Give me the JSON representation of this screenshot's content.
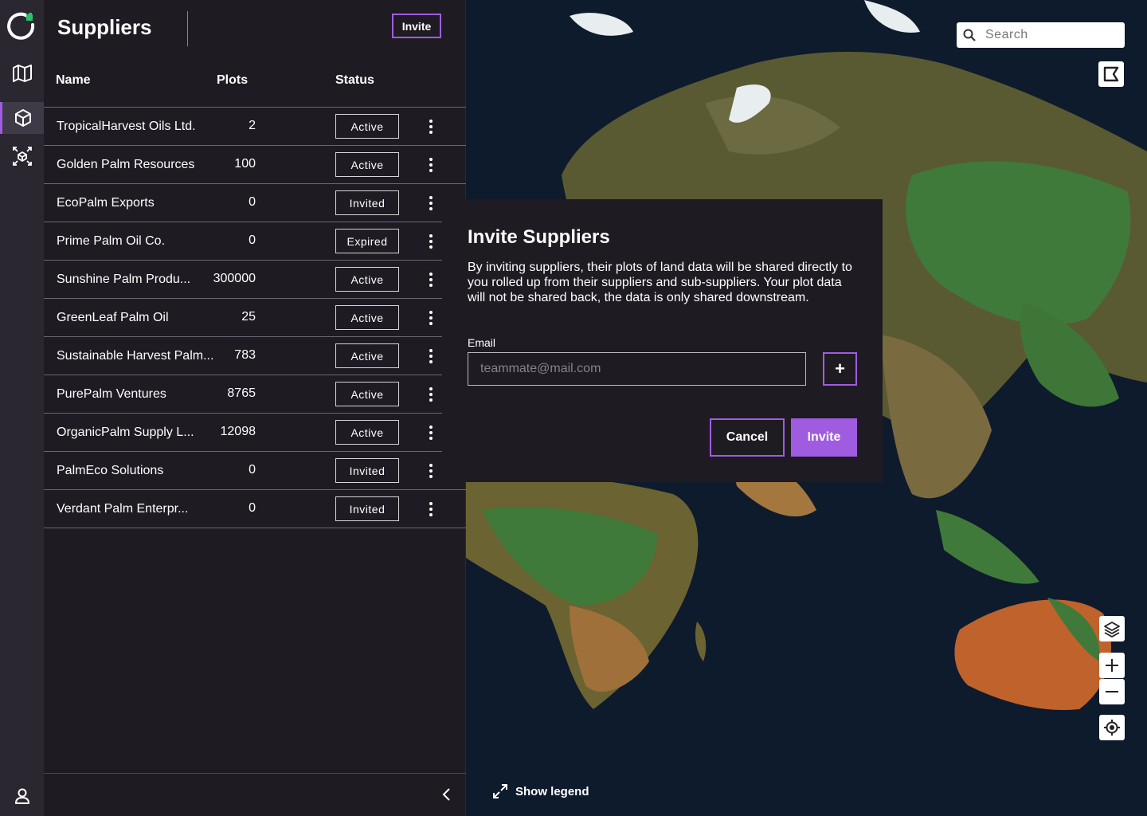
{
  "header": {
    "title": "Suppliers",
    "invite_label": "Invite"
  },
  "table": {
    "columns": [
      "Name",
      "Plots",
      "Status"
    ],
    "rows": [
      {
        "name": "TropicalHarvest Oils Ltd.",
        "plots": "2",
        "status": "Active"
      },
      {
        "name": "Golden Palm Resources",
        "plots": "100",
        "status": "Active"
      },
      {
        "name": "EcoPalm Exports",
        "plots": "0",
        "status": "Invited"
      },
      {
        "name": "Prime Palm Oil Co.",
        "plots": "0",
        "status": "Expired"
      },
      {
        "name": "Sunshine Palm Produ...",
        "plots": "300000",
        "status": "Active"
      },
      {
        "name": "GreenLeaf Palm Oil",
        "plots": "25",
        "status": "Active"
      },
      {
        "name": "Sustainable Harvest Palm...",
        "plots": "783",
        "status": "Active"
      },
      {
        "name": "PurePalm Ventures",
        "plots": "8765",
        "status": "Active"
      },
      {
        "name": "OrganicPalm Supply L...",
        "plots": "12098",
        "status": "Active"
      },
      {
        "name": "PalmEco Solutions",
        "plots": "0",
        "status": "Invited"
      },
      {
        "name": "Verdant Palm Enterpr...",
        "plots": "0",
        "status": "Invited"
      }
    ]
  },
  "map": {
    "search_placeholder": "Search",
    "legend_label": "Show legend"
  },
  "modal": {
    "title": "Invite Suppliers",
    "description": "By inviting suppliers, their plots of land data will be shared directly to you rolled up from their suppliers and sub-suppliers. Your plot data will not be shared back, the data is only shared downstream.",
    "email_label": "Email",
    "email_placeholder": "teammate@mail.com",
    "add_label": "+",
    "cancel_label": "Cancel",
    "submit_label": "Invite"
  },
  "colors": {
    "accent": "#a05ce0",
    "background": "#1e1b23",
    "rail": "#2a2730"
  }
}
